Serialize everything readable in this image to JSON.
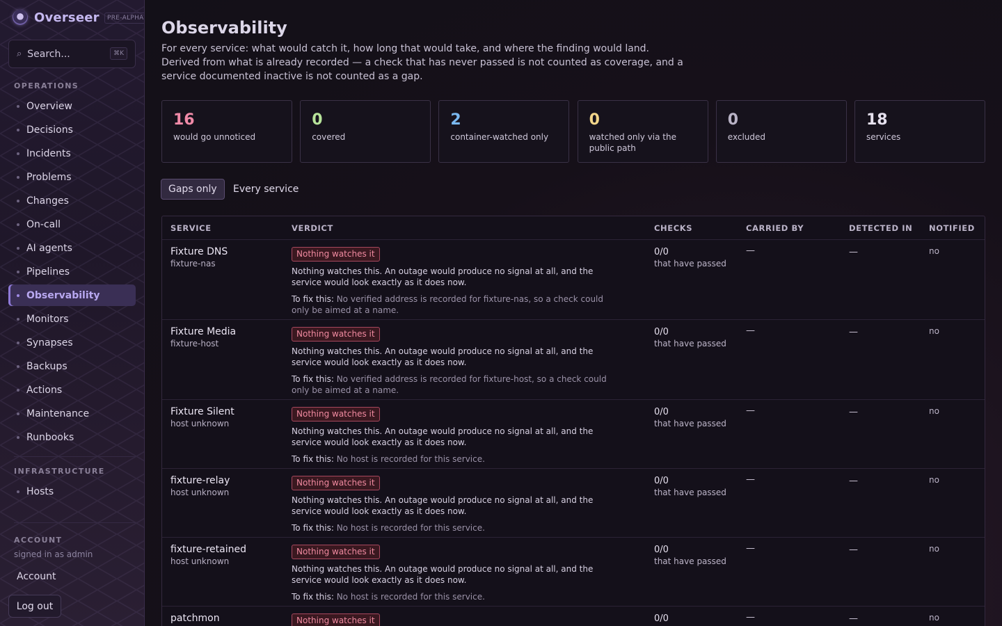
{
  "app": {
    "name": "Overseer",
    "badge": "PRE-ALPHA"
  },
  "search": {
    "placeholder": "Search...",
    "shortcut": "⌘K"
  },
  "sidebar": {
    "operations_label": "OPERATIONS",
    "operations": [
      {
        "label": "Overview"
      },
      {
        "label": "Decisions"
      },
      {
        "label": "Incidents"
      },
      {
        "label": "Problems"
      },
      {
        "label": "Changes"
      },
      {
        "label": "On-call"
      },
      {
        "label": "AI agents"
      },
      {
        "label": "Pipelines"
      },
      {
        "label": "Observability",
        "active": true
      },
      {
        "label": "Monitors"
      },
      {
        "label": "Synapses"
      },
      {
        "label": "Backups"
      },
      {
        "label": "Actions"
      },
      {
        "label": "Maintenance"
      },
      {
        "label": "Runbooks"
      }
    ],
    "infrastructure_label": "INFRASTRUCTURE",
    "infrastructure": [
      {
        "label": "Hosts"
      }
    ],
    "account_label": "ACCOUNT",
    "signed_in": "signed in as admin",
    "account_link": "Account",
    "logout": "Log out"
  },
  "page": {
    "title": "Observability",
    "description": "For every service: what would catch it, how long that would take, and where the finding would land. Derived from what is already recorded — a check that has never passed is not counted as coverage, and a service documented inactive is not counted as a gap."
  },
  "stats": [
    {
      "value": "16",
      "label": "would go unnoticed",
      "color": "#f08aa8"
    },
    {
      "value": "0",
      "label": "covered",
      "color": "#b7e39a"
    },
    {
      "value": "2",
      "label": "container-watched only",
      "color": "#7ab8f0"
    },
    {
      "value": "0",
      "label": "watched only via the public path",
      "color": "#f2d58a"
    },
    {
      "value": "0",
      "label": "excluded",
      "color": "#b9b3c6"
    },
    {
      "value": "18",
      "label": "services",
      "color": "#e6e1ee"
    }
  ],
  "filters": {
    "gaps_only": "Gaps only",
    "every_service": "Every service"
  },
  "table": {
    "headers": {
      "service": "SERVICE",
      "verdict": "VERDICT",
      "checks": "CHECKS",
      "carried_by": "CARRIED BY",
      "detected_in": "DETECTED IN",
      "notified": "NOTIFIED"
    },
    "rows": [
      {
        "name": "Fixture DNS",
        "host": "fixture-nas",
        "badge": "Nothing watches it",
        "verdict": "Nothing watches this. An outage would produce no signal at all, and the service would look exactly as it does now.",
        "fix_label": "To fix this:",
        "fix": "No verified address is recorded for fixture-nas, so a check could only be aimed at a name.",
        "checks": "0/0",
        "checks_sub": "that have passed",
        "carried_by": "—",
        "detected_in": "—",
        "notified": "no"
      },
      {
        "name": "Fixture Media",
        "host": "fixture-host",
        "badge": "Nothing watches it",
        "verdict": "Nothing watches this. An outage would produce no signal at all, and the service would look exactly as it does now.",
        "fix_label": "To fix this:",
        "fix": "No verified address is recorded for fixture-host, so a check could only be aimed at a name.",
        "checks": "0/0",
        "checks_sub": "that have passed",
        "carried_by": "—",
        "detected_in": "—",
        "notified": "no"
      },
      {
        "name": "Fixture Silent",
        "host": "host unknown",
        "badge": "Nothing watches it",
        "verdict": "Nothing watches this. An outage would produce no signal at all, and the service would look exactly as it does now.",
        "fix_label": "To fix this:",
        "fix": "No host is recorded for this service.",
        "checks": "0/0",
        "checks_sub": "that have passed",
        "carried_by": "—",
        "detected_in": "—",
        "notified": "no"
      },
      {
        "name": "fixture-relay",
        "host": "host unknown",
        "badge": "Nothing watches it",
        "verdict": "Nothing watches this. An outage would produce no signal at all, and the service would look exactly as it does now.",
        "fix_label": "To fix this:",
        "fix": "No host is recorded for this service.",
        "checks": "0/0",
        "checks_sub": "that have passed",
        "carried_by": "—",
        "detected_in": "—",
        "notified": "no"
      },
      {
        "name": "fixture-retained",
        "host": "host unknown",
        "badge": "Nothing watches it",
        "verdict": "Nothing watches this. An outage would produce no signal at all, and the service would look exactly as it does now.",
        "fix_label": "To fix this:",
        "fix": "No host is recorded for this service.",
        "checks": "0/0",
        "checks_sub": "that have passed",
        "carried_by": "—",
        "detected_in": "—",
        "notified": "no"
      },
      {
        "name": "patchmon",
        "host": "",
        "badge": "Nothing watches it",
        "verdict": "",
        "fix_label": "",
        "fix": "",
        "checks": "0/0",
        "checks_sub": "",
        "carried_by": "—",
        "detected_in": "—",
        "notified": "no"
      }
    ]
  }
}
